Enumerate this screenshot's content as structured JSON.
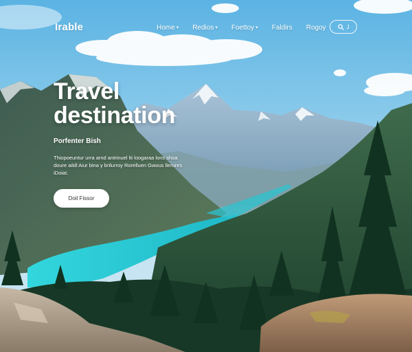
{
  "brand": {
    "logo_text": "Irable"
  },
  "nav": {
    "items": [
      {
        "label": "Home",
        "has_dropdown": true
      },
      {
        "label": "Redios",
        "has_dropdown": true
      },
      {
        "label": "Foettoy",
        "has_dropdown": true
      },
      {
        "label": "Faldirs",
        "has_dropdown": false
      },
      {
        "label": "Rogoy",
        "has_dropdown": false
      }
    ],
    "search": {
      "icon": "search-icon",
      "label": "J"
    }
  },
  "hero": {
    "title_line1": "Travel",
    "title_line2": "destination",
    "subtitle": "Porfenter Bish",
    "description": "Thiopoeuntur urra arnd antrinuel lti loogaraa lons shoa doure aildl Aiur bina y brilurroy Rorelluen Gwous llerunrs iDoiat.",
    "cta_label": "Doil Fissor"
  },
  "colors": {
    "sky_top": "#5fb6e4",
    "lake": "#2cd0d8",
    "forest": "#1f4a34",
    "button_bg": "#ffffff"
  }
}
